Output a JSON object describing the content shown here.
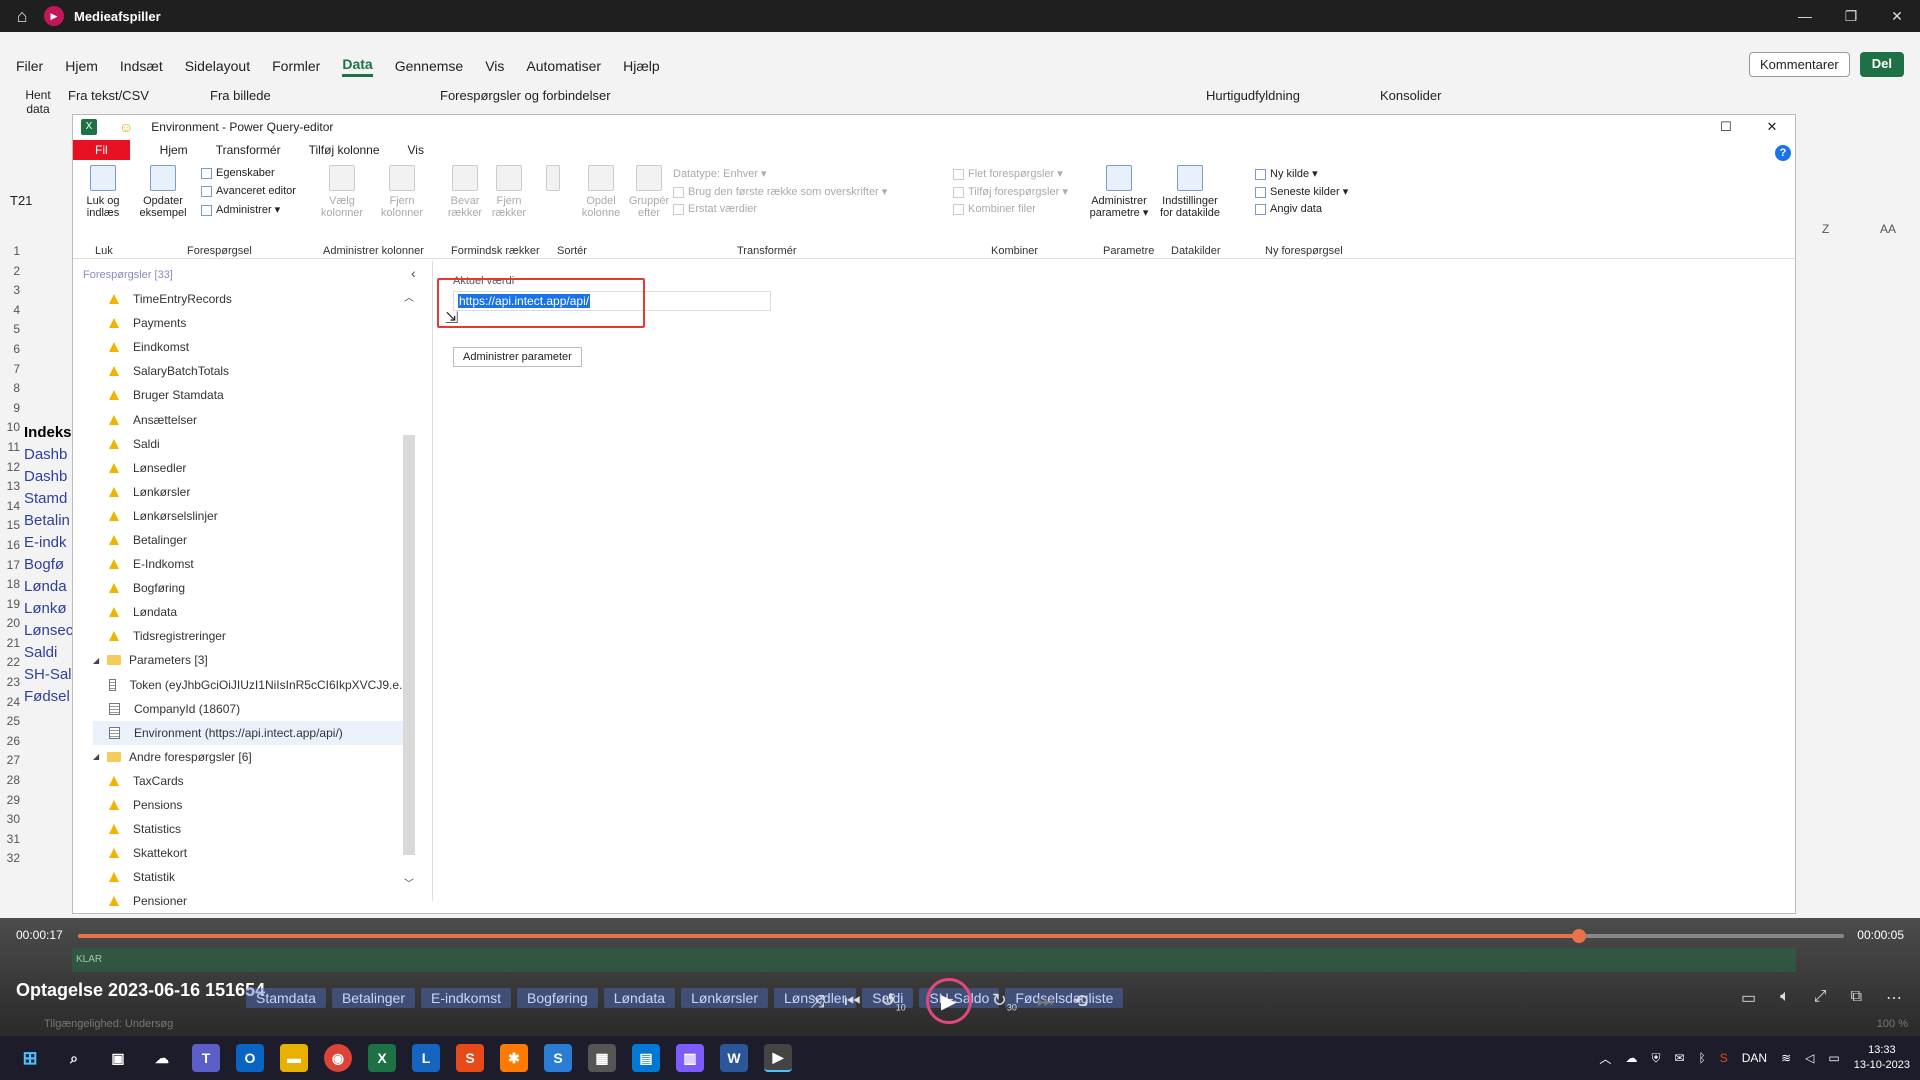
{
  "player": {
    "title": "Medieafspiller",
    "time_elapsed": "00:00:17",
    "time_remaining": "00:00:05",
    "recording_title": "Optagelse 2023-06-16 151654",
    "progress": 0.85,
    "skip_back": "10",
    "skip_fwd": "30"
  },
  "excel": {
    "tabs": [
      "Filer",
      "Hjem",
      "Indsæt",
      "Sidelayout",
      "Formler",
      "Data",
      "Gennemse",
      "Vis",
      "Automatiser",
      "Hjælp"
    ],
    "active_tab": "Data",
    "comments_label": "Kommentarer",
    "share_label": "Del",
    "ribbon": {
      "from_text": "Fra tekst/CSV",
      "from_image": "Fra billede",
      "queries_connections": "Forespørgsler og forbindelser",
      "flash_fill": "Hurtigudfyldning",
      "consolidate": "Konsolider",
      "get_data": "Hent data"
    },
    "namebox": "T21",
    "col_z": "Z",
    "col_aa": "AA",
    "rows": [
      "1",
      "2",
      "3",
      "4",
      "5",
      "6",
      "7",
      "8",
      "9",
      "10",
      "11",
      "12",
      "13",
      "14",
      "15",
      "16",
      "17",
      "18",
      "19",
      "20",
      "21",
      "22",
      "23",
      "24",
      "25",
      "26",
      "27",
      "28",
      "29",
      "30",
      "31",
      "32"
    ],
    "cells": [
      "Indeks",
      "Dashb",
      "Dashb",
      "Stamd",
      "Betalin",
      "E-indk",
      "Bogfø",
      "Lønda",
      "Lønkø",
      "Lønsec",
      "Saldi",
      "SH-Sal",
      "Fødsel"
    ],
    "sheet_tabs": [
      "Stamdata",
      "Betalinger",
      "E-indkomst",
      "Bogføring",
      "Løndata",
      "Lønkørsler",
      "Lønsedler",
      "Saldi",
      "SH-Saldo",
      "Fødselsdagliste"
    ],
    "status_ready": "KLAR",
    "accessibility": "Tilgængelighed: Undersøg",
    "zoom": "100 %"
  },
  "pq": {
    "title": "Environment - Power Query-editor",
    "tabs": [
      "Fil",
      "Hjem",
      "Transformér",
      "Tilføj kolonne",
      "Vis"
    ],
    "ribbon": {
      "close_load": "Luk og indlæs",
      "refresh": "Opdater eksempel",
      "properties": "Egenskaber",
      "adv_editor": "Avanceret editor",
      "manage": "Administrer",
      "choose_cols": "Vælg kolonner",
      "remove_cols": "Fjern kolonner",
      "keep_rows": "Bevar rækker",
      "remove_rows": "Fjern rækker",
      "split_col": "Opdel kolonne",
      "group_by": "Gruppér efter",
      "datatype": "Datatype: Enhver",
      "first_row_header": "Brug den første række som overskrifter",
      "replace_values": "Erstat værdier",
      "merge_queries": "Flet forespørgsler",
      "append_queries": "Tilføj forespørgsler",
      "combine_files": "Kombiner filer",
      "manage_params": "Administrer parametre",
      "datasource_settings": "Indstillinger for datakilde",
      "new_source": "Ny kilde",
      "recent_sources": "Seneste kilder",
      "enter_data": "Angiv data",
      "groups": {
        "close": "Luk",
        "query": "Forespørgsel",
        "manage_cols": "Administrer kolonner",
        "reduce_rows": "Formindsk rækker",
        "sort": "Sortér",
        "transform": "Transformér",
        "combine": "Kombiner",
        "params": "Parametre",
        "datasources": "Datakilder",
        "new_query": "Ny forespørgsel"
      }
    },
    "queries_header": "Forespørgsler [33]",
    "queries": [
      {
        "label": "TimeEntryRecords",
        "kind": "warn"
      },
      {
        "label": "Payments",
        "kind": "warn"
      },
      {
        "label": "Eindkomst",
        "kind": "warn"
      },
      {
        "label": "SalaryBatchTotals",
        "kind": "warn"
      },
      {
        "label": "Bruger Stamdata",
        "kind": "warn"
      },
      {
        "label": "Ansættelser",
        "kind": "warn"
      },
      {
        "label": "Saldi",
        "kind": "warn"
      },
      {
        "label": "Lønsedler",
        "kind": "warn"
      },
      {
        "label": "Lønkørsler",
        "kind": "warn"
      },
      {
        "label": "Lønkørselslinjer",
        "kind": "warn"
      },
      {
        "label": "Betalinger",
        "kind": "warn"
      },
      {
        "label": "E-Indkomst",
        "kind": "warn"
      },
      {
        "label": "Bogføring",
        "kind": "warn"
      },
      {
        "label": "Løndata",
        "kind": "warn"
      },
      {
        "label": "Tidsregistreringer",
        "kind": "warn"
      },
      {
        "label": "Parameters [3]",
        "kind": "folder"
      },
      {
        "label": "Token (eyJhbGciOiJIUzI1NiIsInR5cCI6IkpXVCJ9.e...",
        "kind": "param"
      },
      {
        "label": "CompanyId (18607)",
        "kind": "param"
      },
      {
        "label": "Environment (https://api.intect.app/api/)",
        "kind": "param",
        "selected": true
      },
      {
        "label": "Andre forespørgsler [6]",
        "kind": "folder"
      },
      {
        "label": "TaxCards",
        "kind": "warn"
      },
      {
        "label": "Pensions",
        "kind": "warn"
      },
      {
        "label": "Statistics",
        "kind": "warn"
      },
      {
        "label": "Skattekort",
        "kind": "warn"
      },
      {
        "label": "Statistik",
        "kind": "warn"
      },
      {
        "label": "Pensioner",
        "kind": "warn"
      }
    ],
    "current_value_label": "Aktuel værdi",
    "current_value": "https://api.intect.app/api/",
    "manage_param_btn": "Administrer parameter"
  },
  "taskbar": {
    "language": "DAN",
    "time": "13:33",
    "date": "13-10-2023"
  }
}
